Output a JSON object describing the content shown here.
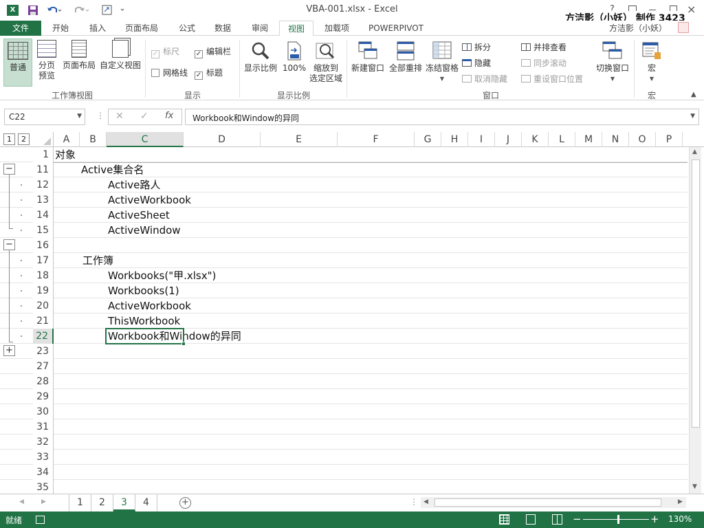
{
  "window": {
    "title": "VBA-001.xlsx - Excel",
    "watermark": "方洁影（小妖） 制作 3423",
    "user": "方洁影（小妖）",
    "help": "?"
  },
  "tabs": [
    {
      "label": "文件"
    },
    {
      "label": "开始"
    },
    {
      "label": "插入"
    },
    {
      "label": "页面布局"
    },
    {
      "label": "公式"
    },
    {
      "label": "数据"
    },
    {
      "label": "审阅"
    },
    {
      "label": "视图"
    },
    {
      "label": "加载项"
    },
    {
      "label": "POWERPIVOT"
    }
  ],
  "active_tab": "视图",
  "ribbon": {
    "workbook_views": {
      "group": "工作簿视图",
      "normal": "普通",
      "page_break_1": "分页",
      "page_break_2": "预览",
      "page_layout": "页面布局",
      "custom_views": "自定义视图"
    },
    "show": {
      "group": "显示",
      "ruler": "标尺",
      "formula_bar": "编辑栏",
      "gridlines": "网格线",
      "headings": "标题"
    },
    "zoom": {
      "group": "显示比例",
      "zoom": "显示比例",
      "zoom100": "100%",
      "zoom_sel_1": "缩放到",
      "zoom_sel_2": "选定区域"
    },
    "window": {
      "group": "窗口",
      "new_window": "新建窗口",
      "arrange_all": "全部重排",
      "freeze": "冻结窗格",
      "split": "拆分",
      "hide": "隐藏",
      "unhide": "取消隐藏",
      "side_by_side": "并排查看",
      "sync_scroll": "同步滚动",
      "reset_pos": "重设窗口位置",
      "switch": "切换窗口"
    },
    "macros": {
      "group": "宏",
      "macros": "宏"
    }
  },
  "formula": {
    "name_box": "C22",
    "fx": "fx",
    "content": "Workbook和Window的异同"
  },
  "outline_levels": [
    "1",
    "2"
  ],
  "columns": [
    "A",
    "B",
    "C",
    "D",
    "E",
    "F",
    "G",
    "H",
    "I",
    "J",
    "K",
    "L",
    "M",
    "N",
    "O",
    "P"
  ],
  "rows": [
    {
      "num": "1",
      "indent": 0,
      "text": "对象"
    },
    {
      "num": "11",
      "indent": 1,
      "text": "Active集合名"
    },
    {
      "num": "12",
      "indent": 2,
      "text": "Active路人"
    },
    {
      "num": "13",
      "indent": 2,
      "text": "ActiveWorkbook"
    },
    {
      "num": "14",
      "indent": 2,
      "text": "ActiveSheet"
    },
    {
      "num": "15",
      "indent": 2,
      "text": "ActiveWindow"
    },
    {
      "num": "16",
      "indent": 0,
      "text": ""
    },
    {
      "num": "17",
      "indent": 1,
      "text": "工作簿"
    },
    {
      "num": "18",
      "indent": 2,
      "text": "Workbooks(\"甲.xlsx\")"
    },
    {
      "num": "19",
      "indent": 2,
      "text": "Workbooks(1)"
    },
    {
      "num": "20",
      "indent": 2,
      "text": "ActiveWorkbook"
    },
    {
      "num": "21",
      "indent": 2,
      "text": "ThisWorkbook"
    },
    {
      "num": "22",
      "indent": 2,
      "text": "Workbook和Window的异同"
    },
    {
      "num": "23",
      "indent": 0,
      "text": ""
    },
    {
      "num": "27",
      "indent": 0,
      "text": ""
    },
    {
      "num": "28",
      "indent": 0,
      "text": ""
    },
    {
      "num": "29",
      "indent": 0,
      "text": ""
    },
    {
      "num": "30",
      "indent": 0,
      "text": ""
    },
    {
      "num": "31",
      "indent": 0,
      "text": ""
    },
    {
      "num": "32",
      "indent": 0,
      "text": ""
    },
    {
      "num": "33",
      "indent": 0,
      "text": ""
    },
    {
      "num": "34",
      "indent": 0,
      "text": ""
    },
    {
      "num": "35",
      "indent": 0,
      "text": ""
    }
  ],
  "sheets": [
    "1",
    "2",
    "3",
    "4"
  ],
  "active_sheet": "3",
  "status": {
    "ready": "就绪",
    "zoom": "130%"
  },
  "colors": {
    "accent": "#217346",
    "selection": "#217346"
  }
}
